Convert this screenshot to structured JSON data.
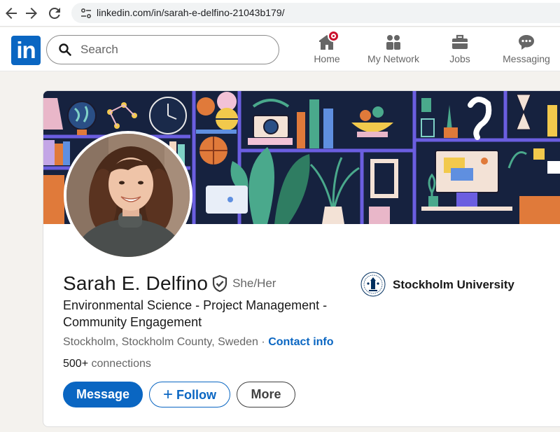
{
  "browser": {
    "url": "linkedin.com/in/sarah-e-delfino-21043b179/",
    "back_icon": "arrow-left-icon",
    "forward_icon": "arrow-right-icon",
    "reload_icon": "reload-icon",
    "site_info_icon": "tune-icon"
  },
  "header": {
    "logo_text": "in",
    "search_placeholder": "Search",
    "nav": [
      {
        "label": "Home",
        "icon": "home-icon",
        "has_notification": true
      },
      {
        "label": "My Network",
        "icon": "people-icon"
      },
      {
        "label": "Jobs",
        "icon": "briefcase-icon"
      },
      {
        "label": "Messaging",
        "icon": "chat-icon"
      }
    ]
  },
  "profile": {
    "name": "Sarah E. Delfino",
    "pronouns": "She/Her",
    "headline": "Environmental Science - Project Management - Community Engagement",
    "location": "Stockholm, Stockholm County, Sweden",
    "separator": "·",
    "contact_info_label": "Contact info",
    "connections": "500+",
    "connections_suffix": "connections",
    "buttons": {
      "message": "Message",
      "follow": "Follow",
      "more": "More"
    },
    "education": {
      "name": "Stockholm University"
    }
  },
  "colors": {
    "brand": "#0a66c2",
    "badge": "#cb112d",
    "banner_bg": "#16223f"
  }
}
